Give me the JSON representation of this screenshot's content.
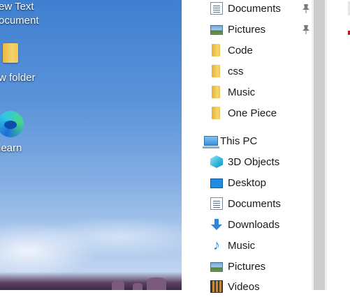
{
  "desktop": {
    "icons": [
      {
        "label_line1": "ew Text",
        "label_line2": "ocument",
        "icon": "text-document-icon"
      },
      {
        "label": "w folder",
        "icon": "folder-icon"
      },
      {
        "label": "learn",
        "icon": "edge-browser-icon"
      }
    ]
  },
  "nav_pane": {
    "quick_access": [
      {
        "label": "Documents",
        "icon": "documents-icon",
        "pinned": true
      },
      {
        "label": "Pictures",
        "icon": "pictures-icon",
        "pinned": true
      },
      {
        "label": "Code",
        "icon": "folder-icon",
        "pinned": false
      },
      {
        "label": "css",
        "icon": "folder-icon",
        "pinned": false
      },
      {
        "label": "Music",
        "icon": "folder-icon",
        "pinned": false
      },
      {
        "label": "One Piece",
        "icon": "folder-icon",
        "pinned": false
      }
    ],
    "this_pc": {
      "label": "This PC",
      "icon": "computer-icon",
      "items": [
        {
          "label": "3D Objects",
          "icon": "3d-objects-icon"
        },
        {
          "label": "Desktop",
          "icon": "desktop-icon"
        },
        {
          "label": "Documents",
          "icon": "documents-icon"
        },
        {
          "label": "Downloads",
          "icon": "downloads-icon"
        },
        {
          "label": "Music",
          "icon": "music-icon"
        },
        {
          "label": "Pictures",
          "icon": "pictures-icon"
        },
        {
          "label": "Videos",
          "icon": "videos-icon"
        }
      ]
    }
  },
  "colors": {
    "pane_background": "#ffffff",
    "scrollbar_thumb": "#cdcdcd",
    "text": "#1a1a1a",
    "pin": "#7a7a7a"
  }
}
